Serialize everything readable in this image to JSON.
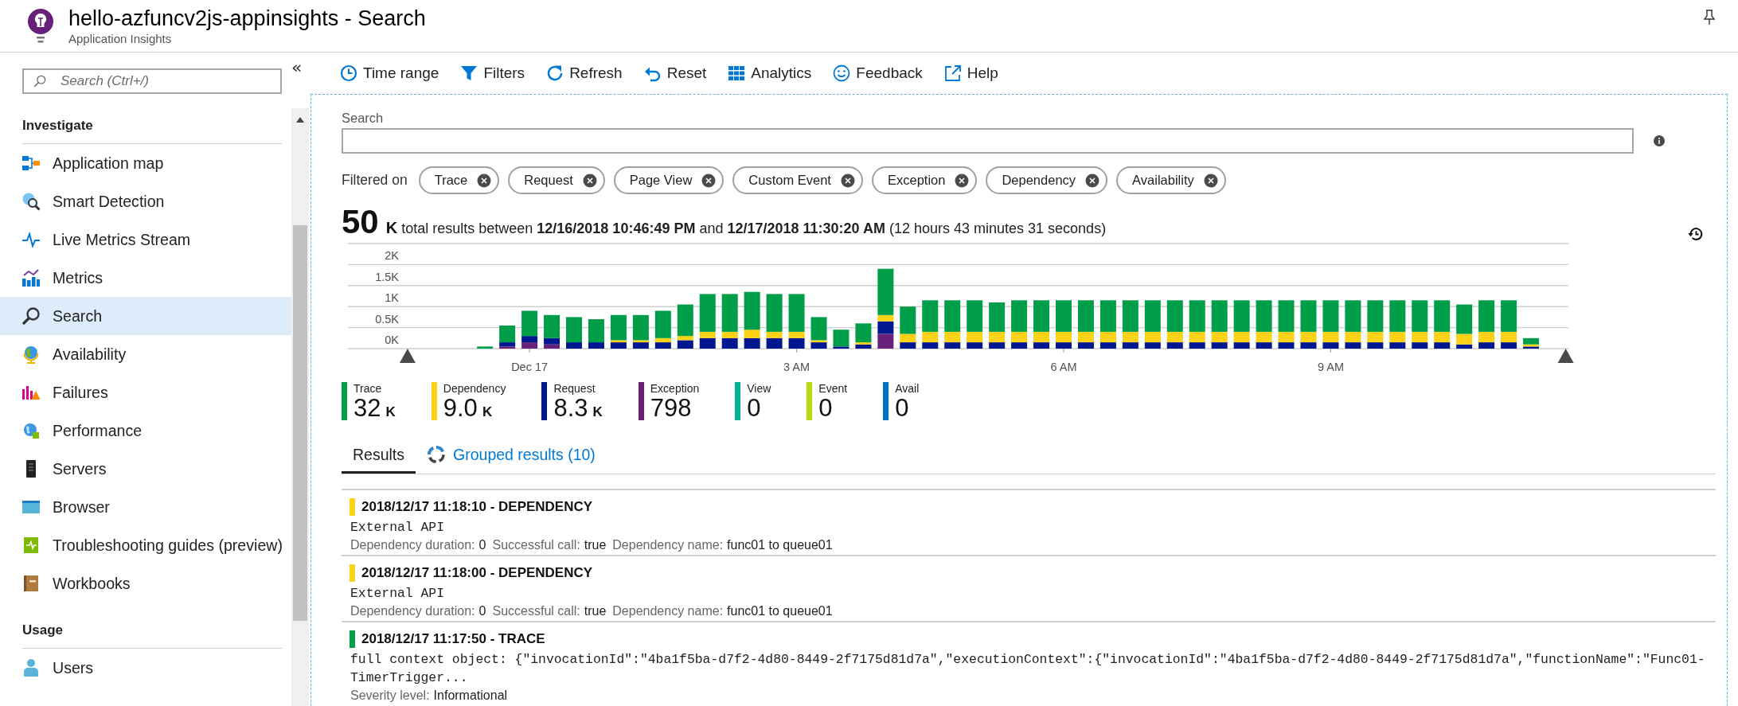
{
  "header": {
    "title": "hello-azfuncv2js-appinsights - Search",
    "subtitle": "Application Insights"
  },
  "sidebar": {
    "search": {
      "placeholder": "Search (Ctrl+/)"
    },
    "collapse_button": "«",
    "sections": [
      {
        "title": "Investigate",
        "items": [
          {
            "label": "Application map",
            "selected": false
          },
          {
            "label": "Smart Detection",
            "selected": false
          },
          {
            "label": "Live Metrics Stream",
            "selected": false
          },
          {
            "label": "Metrics",
            "selected": false
          },
          {
            "label": "Search",
            "selected": true
          },
          {
            "label": "Availability",
            "selected": false
          },
          {
            "label": "Failures",
            "selected": false
          },
          {
            "label": "Performance",
            "selected": false
          },
          {
            "label": "Servers",
            "selected": false
          },
          {
            "label": "Browser",
            "selected": false
          },
          {
            "label": "Troubleshooting guides (preview)",
            "selected": false
          },
          {
            "label": "Workbooks",
            "selected": false
          }
        ]
      },
      {
        "title": "Usage",
        "items": [
          {
            "label": "Users",
            "selected": false
          }
        ]
      }
    ]
  },
  "toolbar": [
    "Time range",
    "Filters",
    "Refresh",
    "Reset",
    "Analytics",
    "Feedback",
    "Help"
  ],
  "search": {
    "label": "Search"
  },
  "filters": {
    "label": "Filtered on",
    "chips": [
      "Trace",
      "Request",
      "Page View",
      "Custom Event",
      "Exception",
      "Dependency",
      "Availability"
    ]
  },
  "summary": {
    "count": "50",
    "unit": "K",
    "text": "total results between **12/16/2018 10:46:49 PM** and **12/17/2018 11:30:20 AM** (12 hours 43 minutes 31 seconds)"
  },
  "chart_data": {
    "type": "bar",
    "stacked": true,
    "grid": true,
    "x": [
      -0.5,
      -0.25,
      0,
      0.25,
      0.5,
      0.75,
      1,
      1.25,
      1.5,
      1.75,
      2,
      2.25,
      2.5,
      2.75,
      3,
      3.25,
      3.5,
      3.75,
      4,
      4.25,
      4.5,
      4.75,
      5,
      5.25,
      5.5,
      5.75,
      6,
      6.25,
      6.5,
      6.75,
      7,
      7.25,
      7.5,
      7.75,
      8,
      8.25,
      8.5,
      8.75,
      9,
      9.25,
      9.5,
      9.75,
      10,
      10.25,
      10.5,
      10.75,
      11,
      11.25
    ],
    "series": [
      {
        "name": "Trace",
        "color": "#009e49",
        "values": [
          50,
          400,
          600,
          550,
          600,
          550,
          600,
          600,
          650,
          750,
          900,
          900,
          900,
          900,
          900,
          550,
          400,
          450,
          1100,
          650,
          750,
          750,
          750,
          700,
          750,
          750,
          750,
          750,
          750,
          750,
          750,
          750,
          750,
          750,
          750,
          750,
          750,
          750,
          750,
          750,
          750,
          750,
          750,
          750,
          700,
          750,
          750,
          150
        ]
      },
      {
        "name": "Dependency",
        "color": "#fcd116",
        "values": [
          0,
          0,
          0,
          0,
          0,
          0,
          50,
          50,
          100,
          100,
          150,
          150,
          200,
          150,
          150,
          50,
          0,
          50,
          150,
          200,
          250,
          250,
          250,
          250,
          250,
          250,
          250,
          250,
          250,
          250,
          250,
          250,
          250,
          250,
          250,
          250,
          250,
          250,
          250,
          250,
          250,
          250,
          250,
          250,
          250,
          250,
          250,
          50
        ]
      },
      {
        "name": "Request",
        "color": "#00188f",
        "values": [
          0,
          100,
          150,
          150,
          150,
          150,
          150,
          150,
          150,
          200,
          250,
          250,
          250,
          250,
          250,
          150,
          50,
          100,
          300,
          150,
          150,
          150,
          150,
          150,
          150,
          150,
          150,
          150,
          150,
          150,
          150,
          150,
          150,
          150,
          150,
          150,
          150,
          150,
          150,
          150,
          150,
          150,
          150,
          150,
          100,
          150,
          150,
          50
        ]
      },
      {
        "name": "Exception",
        "color": "#68217a",
        "values": [
          0,
          50,
          150,
          100,
          0,
          0,
          0,
          0,
          0,
          0,
          0,
          0,
          0,
          0,
          0,
          0,
          0,
          0,
          350,
          0,
          0,
          0,
          0,
          0,
          0,
          0,
          0,
          0,
          0,
          0,
          0,
          0,
          0,
          0,
          0,
          0,
          0,
          0,
          0,
          0,
          0,
          0,
          0,
          0,
          0,
          0,
          0,
          0
        ]
      },
      {
        "name": "View",
        "color": "#00b294",
        "values": [
          0,
          0,
          0,
          0,
          0,
          0,
          0,
          0,
          0,
          0,
          0,
          0,
          0,
          0,
          0,
          0,
          0,
          0,
          0,
          0,
          0,
          0,
          0,
          0,
          0,
          0,
          0,
          0,
          0,
          0,
          0,
          0,
          0,
          0,
          0,
          0,
          0,
          0,
          0,
          0,
          0,
          0,
          0,
          0,
          0,
          0,
          0,
          0
        ]
      },
      {
        "name": "Event",
        "color": "#bad80a",
        "values": [
          0,
          0,
          0,
          0,
          0,
          0,
          0,
          0,
          0,
          0,
          0,
          0,
          0,
          0,
          0,
          0,
          0,
          0,
          0,
          0,
          0,
          0,
          0,
          0,
          0,
          0,
          0,
          0,
          0,
          0,
          0,
          0,
          0,
          0,
          0,
          0,
          0,
          0,
          0,
          0,
          0,
          0,
          0,
          0,
          0,
          0,
          0,
          0
        ]
      },
      {
        "name": "Avail",
        "color": "#0072c6",
        "values": [
          0,
          0,
          0,
          0,
          0,
          0,
          0,
          0,
          0,
          0,
          0,
          0,
          0,
          0,
          0,
          0,
          0,
          0,
          0,
          0,
          0,
          0,
          0,
          0,
          0,
          0,
          0,
          0,
          0,
          0,
          0,
          0,
          0,
          0,
          0,
          0,
          0,
          0,
          0,
          0,
          0,
          0,
          0,
          0,
          0,
          0,
          0,
          0
        ]
      }
    ],
    "xlim": [
      -2.04,
      11.67
    ],
    "ylim": [
      0,
      2500
    ],
    "xticks": [
      {
        "value": 0,
        "label": "Dec 17"
      },
      {
        "value": 3,
        "label": "3 AM"
      },
      {
        "value": 6,
        "label": "6 AM"
      },
      {
        "value": 9,
        "label": "9 AM"
      }
    ],
    "yticks": [
      {
        "value": 0,
        "label": "0K"
      },
      {
        "value": 500,
        "label": "0.5K"
      },
      {
        "value": 1000,
        "label": "1K"
      },
      {
        "value": 1500,
        "label": "1.5K"
      },
      {
        "value": 2000,
        "label": "2K"
      }
    ]
  },
  "legend": [
    {
      "value": "32",
      "unit": "K"
    },
    {
      "value": "9.0",
      "unit": "K"
    },
    {
      "value": "8.3",
      "unit": "K"
    },
    {
      "value": "798"
    },
    {
      "value": "0"
    },
    {
      "value": "0"
    },
    {
      "value": "0"
    }
  ],
  "tabs": [
    {
      "label": "Results",
      "selected": true
    },
    {
      "label": "Grouped results (10)",
      "selected": false
    }
  ],
  "results": [
    {
      "color": "#fcd116",
      "title": "2018/12/17 11:18:10 - DEPENDENCY",
      "message": "External API",
      "fields": [
        {
          "label": "Dependency duration:",
          "value": "0"
        },
        {
          "label": "Successful call:",
          "value": "true"
        },
        {
          "label": "Dependency name:",
          "value": "func01 to queue01"
        }
      ]
    },
    {
      "color": "#fcd116",
      "title": "2018/12/17 11:18:00 - DEPENDENCY",
      "message": "External API",
      "fields": [
        {
          "label": "Dependency duration:",
          "value": "0"
        },
        {
          "label": "Successful call:",
          "value": "true"
        },
        {
          "label": "Dependency name:",
          "value": "func01 to queue01"
        }
      ]
    },
    {
      "color": "#009e49",
      "title": "2018/12/17 11:17:50 - TRACE",
      "message": "full context object: {\"invocationId\":\"4ba1f5ba-d7f2-4d80-8449-2f7175d81d7a\",\"executionContext\":{\"invocationId\":\"4ba1f5ba-d7f2-4d80-8449-2f7175d81d7a\",\"functionName\":\"Func01-TimerTrigger...",
      "fields": [
        {
          "label": "Severity level:",
          "value": "Informational"
        }
      ]
    }
  ]
}
